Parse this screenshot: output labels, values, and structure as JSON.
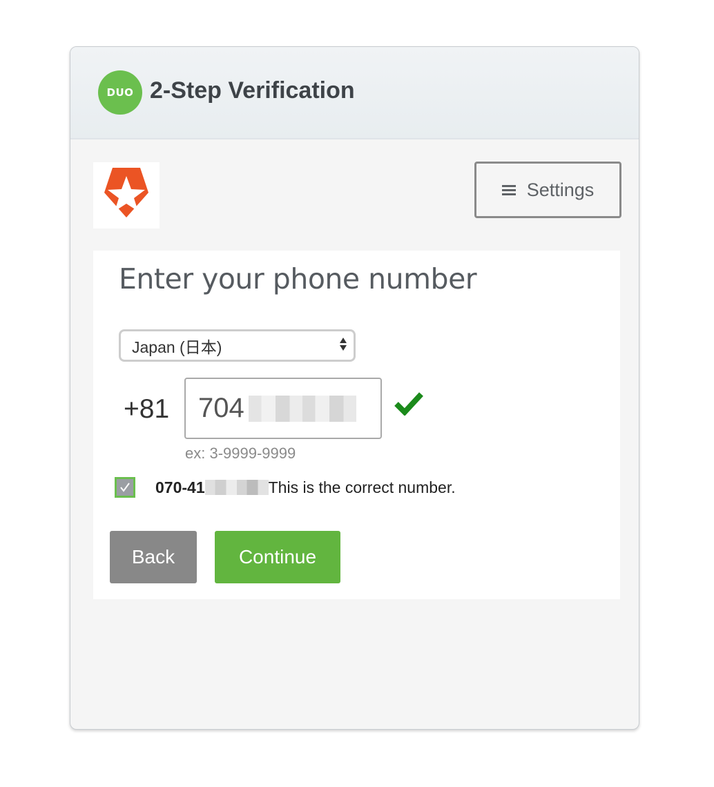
{
  "header": {
    "logo_text": "DUO",
    "title": "2-Step Verification"
  },
  "toolbar": {
    "settings_label": "Settings"
  },
  "form": {
    "title": "Enter your phone number",
    "country": "Japan (日本)",
    "country_code": "+81",
    "phone_value_visible": "704",
    "phone_hint": "ex: 3-9999-9999",
    "confirm_number_prefix": "070-41",
    "confirm_text": "This is the correct number.",
    "confirm_checked": true
  },
  "actions": {
    "back_label": "Back",
    "continue_label": "Continue"
  },
  "colors": {
    "duo_green": "#6bbf4e",
    "continue_green": "#62b53f",
    "check_green": "#1b8a1b",
    "back_gray": "#888888",
    "brand_orange": "#eb5424"
  },
  "icons": {
    "duo_logo": "duo-logo-icon",
    "brand_logo": "auth0-shield-star-icon",
    "settings": "hamburger-menu-icon",
    "valid": "checkmark-icon",
    "select_arrows": "select-updown-icon"
  }
}
